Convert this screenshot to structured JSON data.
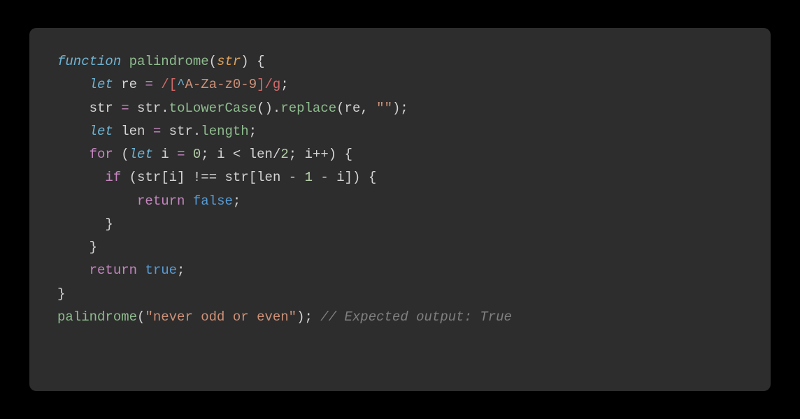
{
  "code": {
    "kw_function": "function",
    "fn_palindrome": "palindrome",
    "param_str": "str",
    "kw_let": "let",
    "var_re": "re",
    "regex_open": "/",
    "regex_brkt_open": "[",
    "regex_neg": "^",
    "regex_class": "A-Za-z0-9",
    "regex_brkt_close": "]",
    "regex_close": "/",
    "regex_flag": "g",
    "var_str": "str",
    "method_toLowerCase": "toLowerCase",
    "method_replace": "replace",
    "str_empty": "\"\"",
    "var_len": "len",
    "prop_length": "length",
    "kw_for": "for",
    "var_i": "i",
    "num_0": "0",
    "num_2": "2",
    "num_1a": "1",
    "num_1b": "1",
    "kw_if": "if",
    "kw_return": "return",
    "bool_false": "false",
    "bool_true": "true",
    "call_arg": "\"never odd or even\"",
    "comment": "// Expected output: True"
  }
}
